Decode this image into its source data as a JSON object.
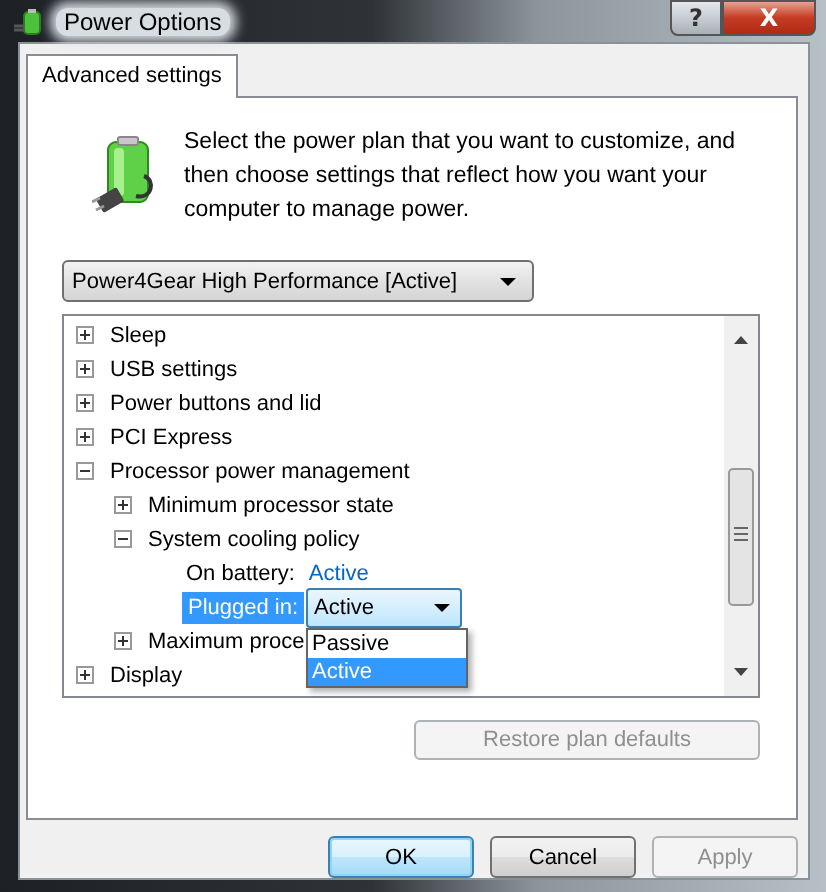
{
  "window": {
    "title": "Power Options",
    "buttons": [
      "?",
      "X"
    ]
  },
  "tabs": [
    {
      "label": "Advanced settings",
      "selected": true
    }
  ],
  "intro": "Select the power plan that you want to customize, and then choose settings that reflect how you want your computer to manage power.",
  "plan_dropdown": {
    "value": "Power4Gear High Performance [Active]"
  },
  "tree": [
    {
      "kind": "group",
      "label": "Sleep",
      "expanded": false
    },
    {
      "kind": "group",
      "label": "USB settings",
      "expanded": false
    },
    {
      "kind": "group",
      "label": "Power buttons and lid",
      "expanded": false
    },
    {
      "kind": "group",
      "label": "PCI Express",
      "expanded": false
    },
    {
      "kind": "group",
      "label": "Processor power management",
      "expanded": true,
      "children": [
        {
          "kind": "group",
          "label": "Minimum processor state",
          "expanded": false
        },
        {
          "kind": "group",
          "label": "System cooling policy",
          "expanded": true,
          "children": [
            {
              "kind": "value",
              "label": "On battery:",
              "value": "Active"
            },
            {
              "kind": "edit",
              "label": "Plugged in:",
              "selected": true,
              "value": "Active",
              "options": [
                {
                  "label": "Passive",
                  "selected": false
                },
                {
                  "label": "Active",
                  "selected": true
                }
              ]
            }
          ]
        },
        {
          "kind": "group",
          "label": "Maximum proce",
          "expanded": false
        }
      ]
    },
    {
      "kind": "group",
      "label": "Display",
      "expanded": false
    }
  ],
  "restore_button": {
    "label": "Restore plan defaults",
    "disabled": true
  },
  "buttons": [
    {
      "label": "OK",
      "disabled": false,
      "default": true
    },
    {
      "label": "Cancel",
      "disabled": false,
      "default": false
    },
    {
      "label": "Apply",
      "disabled": true,
      "default": false
    }
  ]
}
